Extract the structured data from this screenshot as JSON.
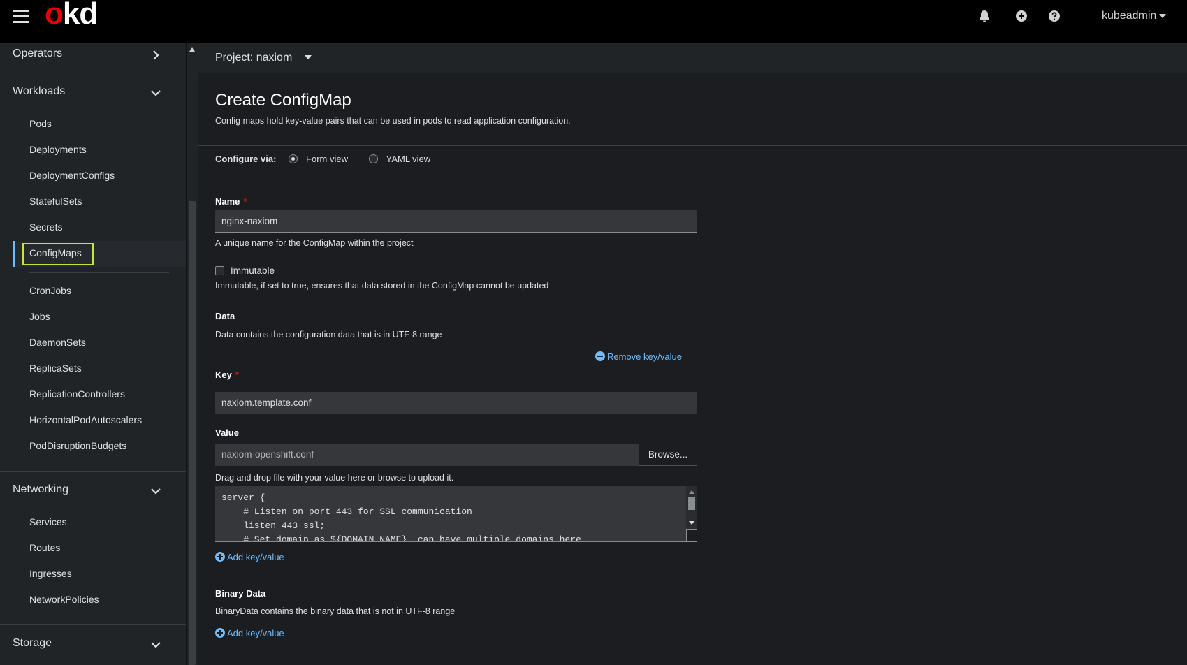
{
  "masthead": {
    "logo_o": "o",
    "logo_rest": "kd",
    "user": "kubeadmin"
  },
  "sidebar": {
    "groups": [
      {
        "label": "Operators"
      },
      {
        "label": "Workloads"
      },
      {
        "label": "Networking"
      },
      {
        "label": "Storage"
      }
    ],
    "workloads": [
      "Pods",
      "Deployments",
      "DeploymentConfigs",
      "StatefulSets",
      "Secrets",
      "ConfigMaps",
      "CronJobs",
      "Jobs",
      "DaemonSets",
      "ReplicaSets",
      "ReplicationControllers",
      "HorizontalPodAutoscalers",
      "PodDisruptionBudgets"
    ],
    "networking": [
      "Services",
      "Routes",
      "Ingresses",
      "NetworkPolicies"
    ]
  },
  "project": {
    "label": "Project: naxiom"
  },
  "page": {
    "title": "Create ConfigMap",
    "description": "Config maps hold key-value pairs that can be used in pods to read application configuration."
  },
  "configure": {
    "label": "Configure via:",
    "form_view": "Form view",
    "yaml_view": "YAML view"
  },
  "form": {
    "name_label": "Name",
    "required_mark": "*",
    "name_value": "nginx-naxiom",
    "name_helper": "A unique name for the ConfigMap within the project",
    "immutable_label": "Immutable",
    "immutable_helper": "Immutable, if set to true, ensures that data stored in the ConfigMap cannot be updated",
    "data_label": "Data",
    "data_helper": "Data contains the configuration data that is in UTF-8 range",
    "remove_kv": "Remove key/value",
    "key_label": "Key",
    "key_value": "naxiom.template.conf",
    "value_label": "Value",
    "value_filename": "naxiom-openshift.conf",
    "browse": "Browse...",
    "value_helper": "Drag and drop file with your value here or browse to upload it.",
    "value_content": "server {\n    # Listen on port 443 for SSL communication\n    listen 443 ssl;\n    # Set domain as ${DOMAIN_NAME}, can have multiple domains here",
    "add_kv": "Add key/value",
    "binary_label": "Binary Data",
    "binary_helper": "BinaryData contains the binary data that is not in UTF-8 range",
    "binary_add_kv": "Add key/value"
  },
  "colors": {
    "accent": "#73bcf7",
    "brand": "#ee0000",
    "highlight": "#c8e63a",
    "required": "#c9190b"
  }
}
